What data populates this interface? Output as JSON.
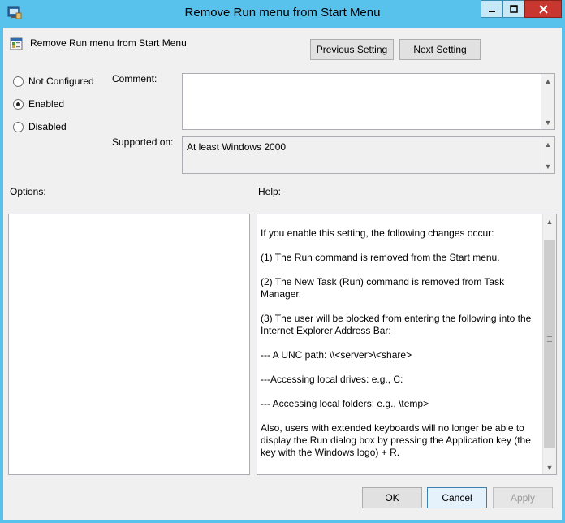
{
  "window": {
    "title": "Remove Run menu from Start Menu",
    "controls": {
      "minimize": "minimize-icon",
      "maximize": "maximize-icon",
      "close": "close-icon"
    }
  },
  "header": {
    "setting_name": "Remove Run menu from Start Menu",
    "previous_label": "Previous Setting",
    "next_label": "Next Setting"
  },
  "state": {
    "options": [
      {
        "label": "Not Configured",
        "selected": false
      },
      {
        "label": "Enabled",
        "selected": true
      },
      {
        "label": "Disabled",
        "selected": false
      }
    ]
  },
  "comment": {
    "label": "Comment:",
    "value": ""
  },
  "supported": {
    "label": "Supported on:",
    "value": "At least Windows 2000"
  },
  "options_panel": {
    "label": "Options:"
  },
  "help_panel": {
    "label": "Help:",
    "paragraphs": [
      "If you enable this setting, the following changes occur:",
      "(1) The Run command is removed from the Start menu.",
      "(2) The New Task (Run) command is removed from Task Manager.",
      "(3) The user will be blocked from entering the following into the Internet Explorer Address Bar:",
      "--- A UNC path: \\\\<server>\\<share>",
      "---Accessing local drives:  e.g., C:",
      "--- Accessing local folders: e.g., \\temp>",
      "Also, users with extended keyboards will no longer be able to display the Run dialog box by pressing the Application key (the key with the Windows logo) + R."
    ]
  },
  "footer": {
    "ok_label": "OK",
    "cancel_label": "Cancel",
    "apply_label": "Apply"
  }
}
